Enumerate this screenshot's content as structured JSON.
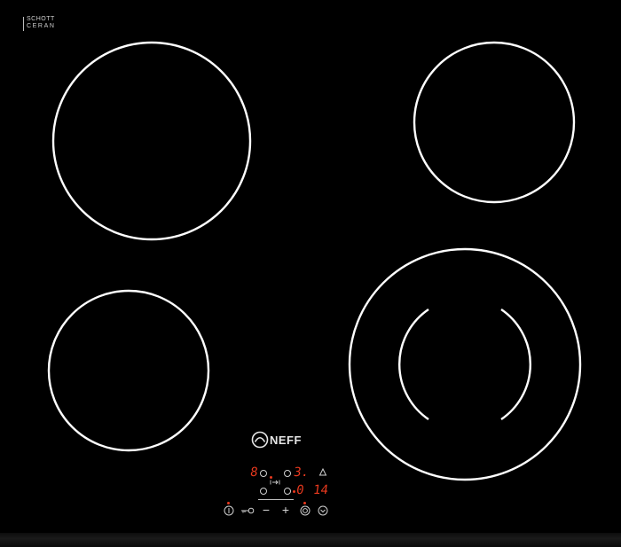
{
  "certification": {
    "line1": "SCHOTT",
    "line2": "CERAN"
  },
  "brand": {
    "name": "NEFF"
  },
  "display": {
    "zone_front_left_level": "8",
    "zone_rear_left_level": "3.",
    "zone_rear_right_level": "0",
    "timer_minutes": "14"
  },
  "controls": {
    "minus_label": "−",
    "plus_label": "+"
  },
  "icons": {
    "power": "power-icon",
    "lock": "child-lock-icon",
    "bell": "bell-icon",
    "timer": "timer-icon",
    "dual_zone": "dual-zone-icon",
    "extend": "zone-extend-icon"
  },
  "colors": {
    "glass": "#000000",
    "ring": "#ffffff",
    "led": "#e8391e",
    "print": "#d0d0d0"
  }
}
